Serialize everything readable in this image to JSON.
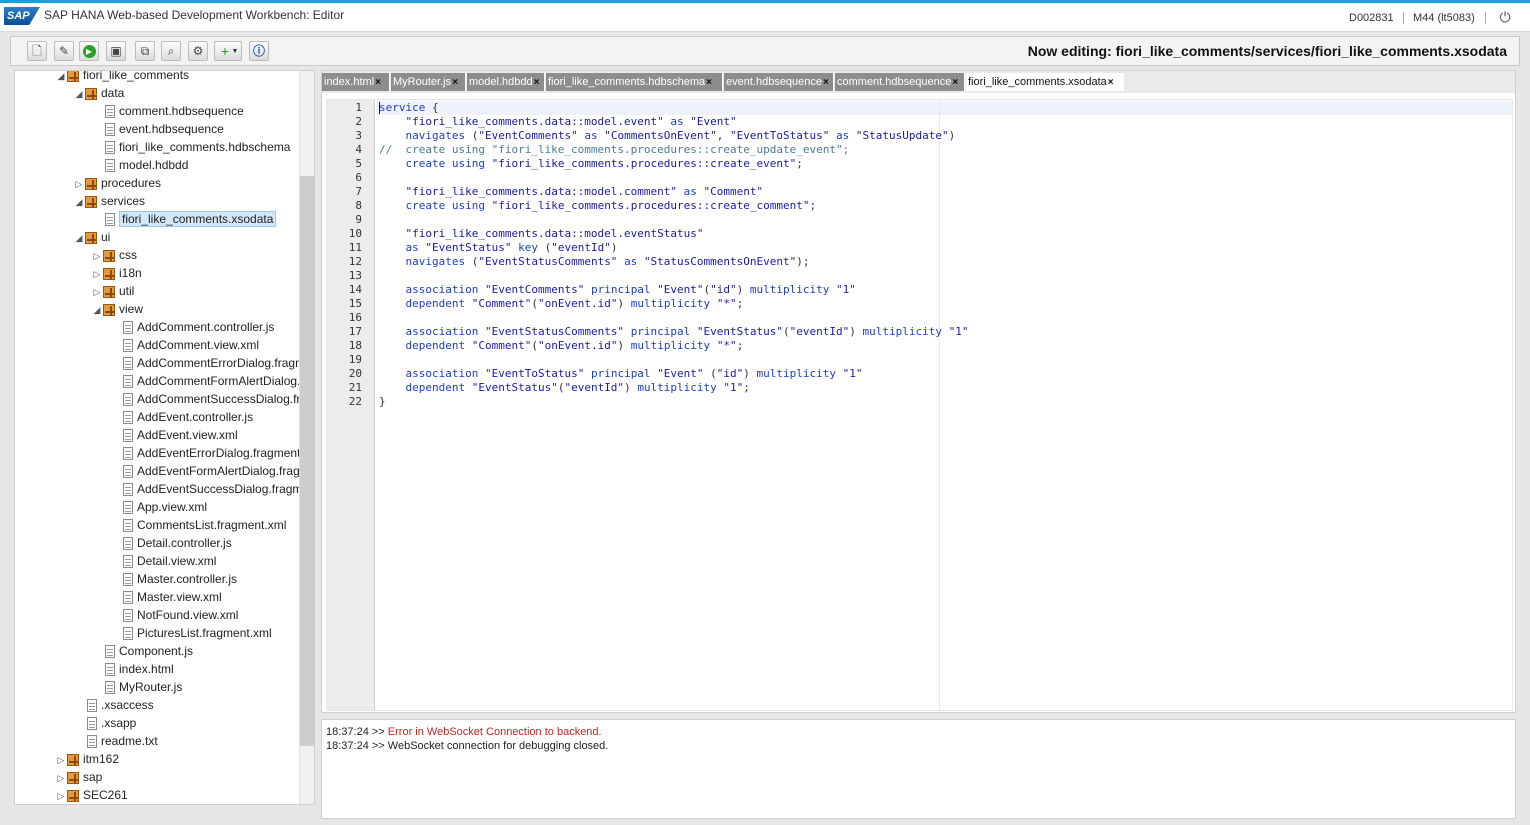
{
  "header": {
    "logo_text": "SAP",
    "title": "SAP HANA Web-based Development Workbench: Editor",
    "user": "D002831",
    "system": "M44 (lt5083)"
  },
  "toolbar": {
    "now_editing": "Now editing: fiori_like_comments/services/fiori_like_comments.xsodata",
    "buttons": [
      "new-file",
      "new-folder",
      "run",
      "save",
      "save-all",
      "search",
      "settings",
      "add",
      "info"
    ]
  },
  "tree": [
    {
      "label": "fiori_like_comments",
      "type": "package",
      "depth": 0,
      "expanded": true
    },
    {
      "label": "data",
      "type": "package",
      "depth": 1,
      "expanded": true
    },
    {
      "label": "comment.hdbsequence",
      "type": "file",
      "depth": 2
    },
    {
      "label": "event.hdbsequence",
      "type": "file",
      "depth": 2
    },
    {
      "label": "fiori_like_comments.hdbschema",
      "type": "file",
      "depth": 2
    },
    {
      "label": "model.hdbdd",
      "type": "file",
      "depth": 2
    },
    {
      "label": "procedures",
      "type": "package",
      "depth": 1,
      "expanded": false
    },
    {
      "label": "services",
      "type": "package",
      "depth": 1,
      "expanded": true
    },
    {
      "label": "fiori_like_comments.xsodata",
      "type": "file",
      "depth": 2,
      "selected": true
    },
    {
      "label": "ui",
      "type": "package",
      "depth": 1,
      "expanded": true
    },
    {
      "label": "css",
      "type": "package",
      "depth": 2,
      "expanded": false
    },
    {
      "label": "i18n",
      "type": "package",
      "depth": 2,
      "expanded": false
    },
    {
      "label": "util",
      "type": "package",
      "depth": 2,
      "expanded": false
    },
    {
      "label": "view",
      "type": "package",
      "depth": 2,
      "expanded": true
    },
    {
      "label": "AddComment.controller.js",
      "type": "file",
      "depth": 3
    },
    {
      "label": "AddComment.view.xml",
      "type": "file",
      "depth": 3
    },
    {
      "label": "AddCommentErrorDialog.fragment.xml",
      "type": "file",
      "depth": 3
    },
    {
      "label": "AddCommentFormAlertDialog.fragment.xml",
      "type": "file",
      "depth": 3
    },
    {
      "label": "AddCommentSuccessDialog.fragment.xml",
      "type": "file",
      "depth": 3
    },
    {
      "label": "AddEvent.controller.js",
      "type": "file",
      "depth": 3
    },
    {
      "label": "AddEvent.view.xml",
      "type": "file",
      "depth": 3
    },
    {
      "label": "AddEventErrorDialog.fragment.xml",
      "type": "file",
      "depth": 3
    },
    {
      "label": "AddEventFormAlertDialog.fragment.xml",
      "type": "file",
      "depth": 3
    },
    {
      "label": "AddEventSuccessDialog.fragment.xml",
      "type": "file",
      "depth": 3
    },
    {
      "label": "App.view.xml",
      "type": "file",
      "depth": 3
    },
    {
      "label": "CommentsList.fragment.xml",
      "type": "file",
      "depth": 3
    },
    {
      "label": "Detail.controller.js",
      "type": "file",
      "depth": 3
    },
    {
      "label": "Detail.view.xml",
      "type": "file",
      "depth": 3
    },
    {
      "label": "Master.controller.js",
      "type": "file",
      "depth": 3
    },
    {
      "label": "Master.view.xml",
      "type": "file",
      "depth": 3
    },
    {
      "label": "NotFound.view.xml",
      "type": "file",
      "depth": 3
    },
    {
      "label": "PicturesList.fragment.xml",
      "type": "file",
      "depth": 3
    },
    {
      "label": "Component.js",
      "type": "file",
      "depth": 2
    },
    {
      "label": "index.html",
      "type": "file",
      "depth": 2
    },
    {
      "label": "MyRouter.js",
      "type": "file",
      "depth": 2
    },
    {
      "label": ".xsaccess",
      "type": "file",
      "depth": 1
    },
    {
      "label": ".xsapp",
      "type": "file",
      "depth": 1
    },
    {
      "label": "readme.txt",
      "type": "file",
      "depth": 1
    },
    {
      "label": "itm162",
      "type": "package",
      "depth": 0,
      "expanded": false
    },
    {
      "label": "sap",
      "type": "package",
      "depth": 0,
      "expanded": false
    },
    {
      "label": "SEC261",
      "type": "package",
      "depth": 0,
      "expanded": false
    }
  ],
  "tabs": [
    {
      "label": "index.html",
      "active": false
    },
    {
      "label": "MyRouter.js",
      "active": false
    },
    {
      "label": "model.hdbdd",
      "active": false
    },
    {
      "label": "fiori_like_comments.hdbschema",
      "active": false
    },
    {
      "label": "event.hdbsequence",
      "active": false
    },
    {
      "label": "comment.hdbsequence",
      "active": false
    },
    {
      "label": "fiori_like_comments.xsodata",
      "active": true
    }
  ],
  "tab_close_glyph": "×",
  "code_lines": [
    "service {",
    "    \"fiori_like_comments.data::model.event\" as \"Event\"",
    "    navigates (\"EventComments\" as \"CommentsOnEvent\", \"EventToStatus\" as \"StatusUpdate\")",
    "//  create using \"fiori_like_comments.procedures::create_update_event\";",
    "    create using \"fiori_like_comments.procedures::create_event\";",
    "",
    "    \"fiori_like_comments.data::model.comment\" as \"Comment\"",
    "    create using \"fiori_like_comments.procedures::create_comment\";",
    "",
    "    \"fiori_like_comments.data::model.eventStatus\"",
    "    as \"EventStatus\" key (\"eventId\")",
    "    navigates (\"EventStatusComments\" as \"StatusCommentsOnEvent\");",
    "",
    "    association \"EventComments\" principal \"Event\"(\"id\") multiplicity \"1\"",
    "    dependent \"Comment\"(\"onEvent.id\") multiplicity \"*\";",
    "",
    "    association \"EventStatusComments\" principal \"EventStatus\"(\"eventId\") multiplicity \"1\"",
    "    dependent \"Comment\"(\"onEvent.id\") multiplicity \"*\";",
    "",
    "    association \"EventToStatus\" principal \"Event\" (\"id\") multiplicity \"1\"",
    "    dependent \"EventStatus\"(\"eventId\") multiplicity \"1\";",
    "}"
  ],
  "console": [
    {
      "time": "18:37:24 >>",
      "message": "Error in WebSocket Connection to backend.",
      "error": true
    },
    {
      "time": "18:37:24 >>",
      "message": "WebSocket connection for debugging closed.",
      "error": false
    }
  ],
  "colors": {
    "accent": "#1a9fd8",
    "keyword": "#1f3cc4",
    "string": "#1a1aa6",
    "comment": "#4d7a97",
    "error": "#c0261f"
  }
}
